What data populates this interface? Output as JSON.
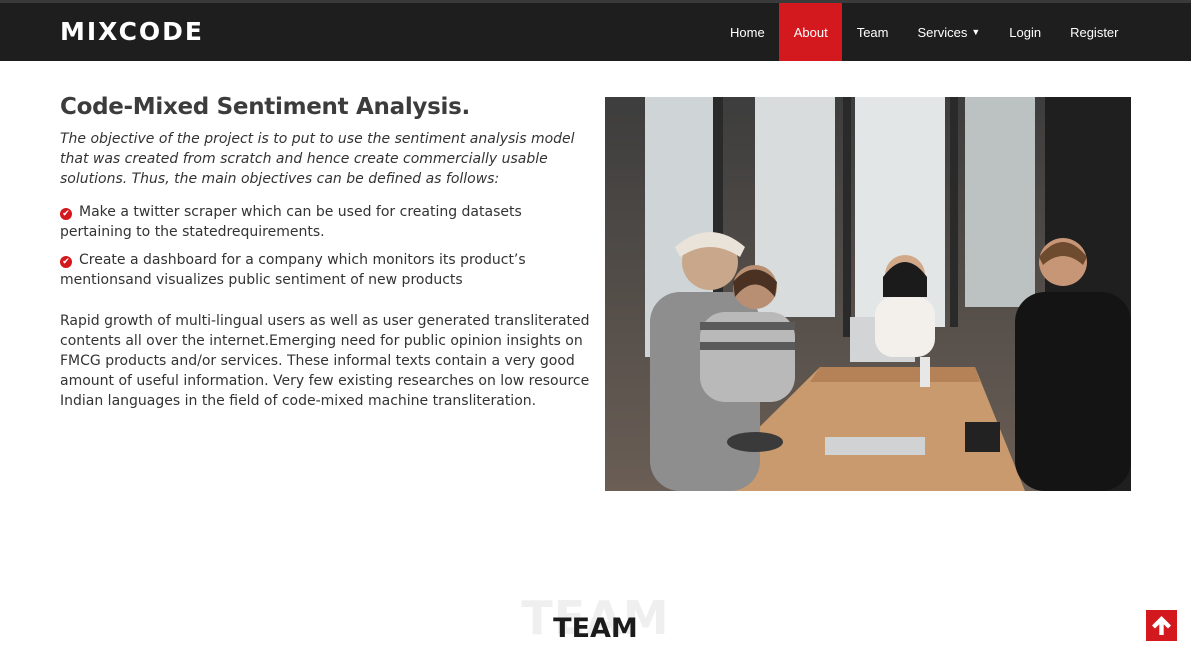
{
  "brand": {
    "logo": "MIXCODE"
  },
  "nav": {
    "items": [
      {
        "label": "Home",
        "active": false
      },
      {
        "label": "About",
        "active": true
      },
      {
        "label": "Team",
        "active": false
      },
      {
        "label": "Services",
        "active": false,
        "dropdown": true
      },
      {
        "label": "Login",
        "active": false
      },
      {
        "label": "Register",
        "active": false
      }
    ]
  },
  "about": {
    "title": "Code-Mixed Sentiment Analysis.",
    "intro": "The objective of the project is to put to use the sentiment analysis model that was created from scratch and hence create commercially usable solutions. Thus, the main objectives can be defined as follows:",
    "bullets": [
      "Make a twitter scraper which can be used for creating datasets pertaining to the statedrequirements.",
      "Create a dashboard for a company which monitors its product’s mentionsand visualizes public sentiment of new products"
    ],
    "paragraph": "Rapid growth of multi-lingual users as well as user generated transliterated contents all over the internet.Emerging need for public opinion insights on FMCG products and/or services. These informal texts contain a very good amount of useful information. Very few existing researches on low resource Indian languages in the field of code-mixed machine transliteration."
  },
  "team": {
    "ghost_title": "TEAM",
    "title": "TEAM"
  },
  "colors": {
    "accent": "#d3181e",
    "navbar": "#1e1e1e"
  },
  "icons": {
    "bullet": "check-circle-icon",
    "back_to_top": "arrow-up-icon",
    "dropdown": "chevron-down-icon"
  }
}
